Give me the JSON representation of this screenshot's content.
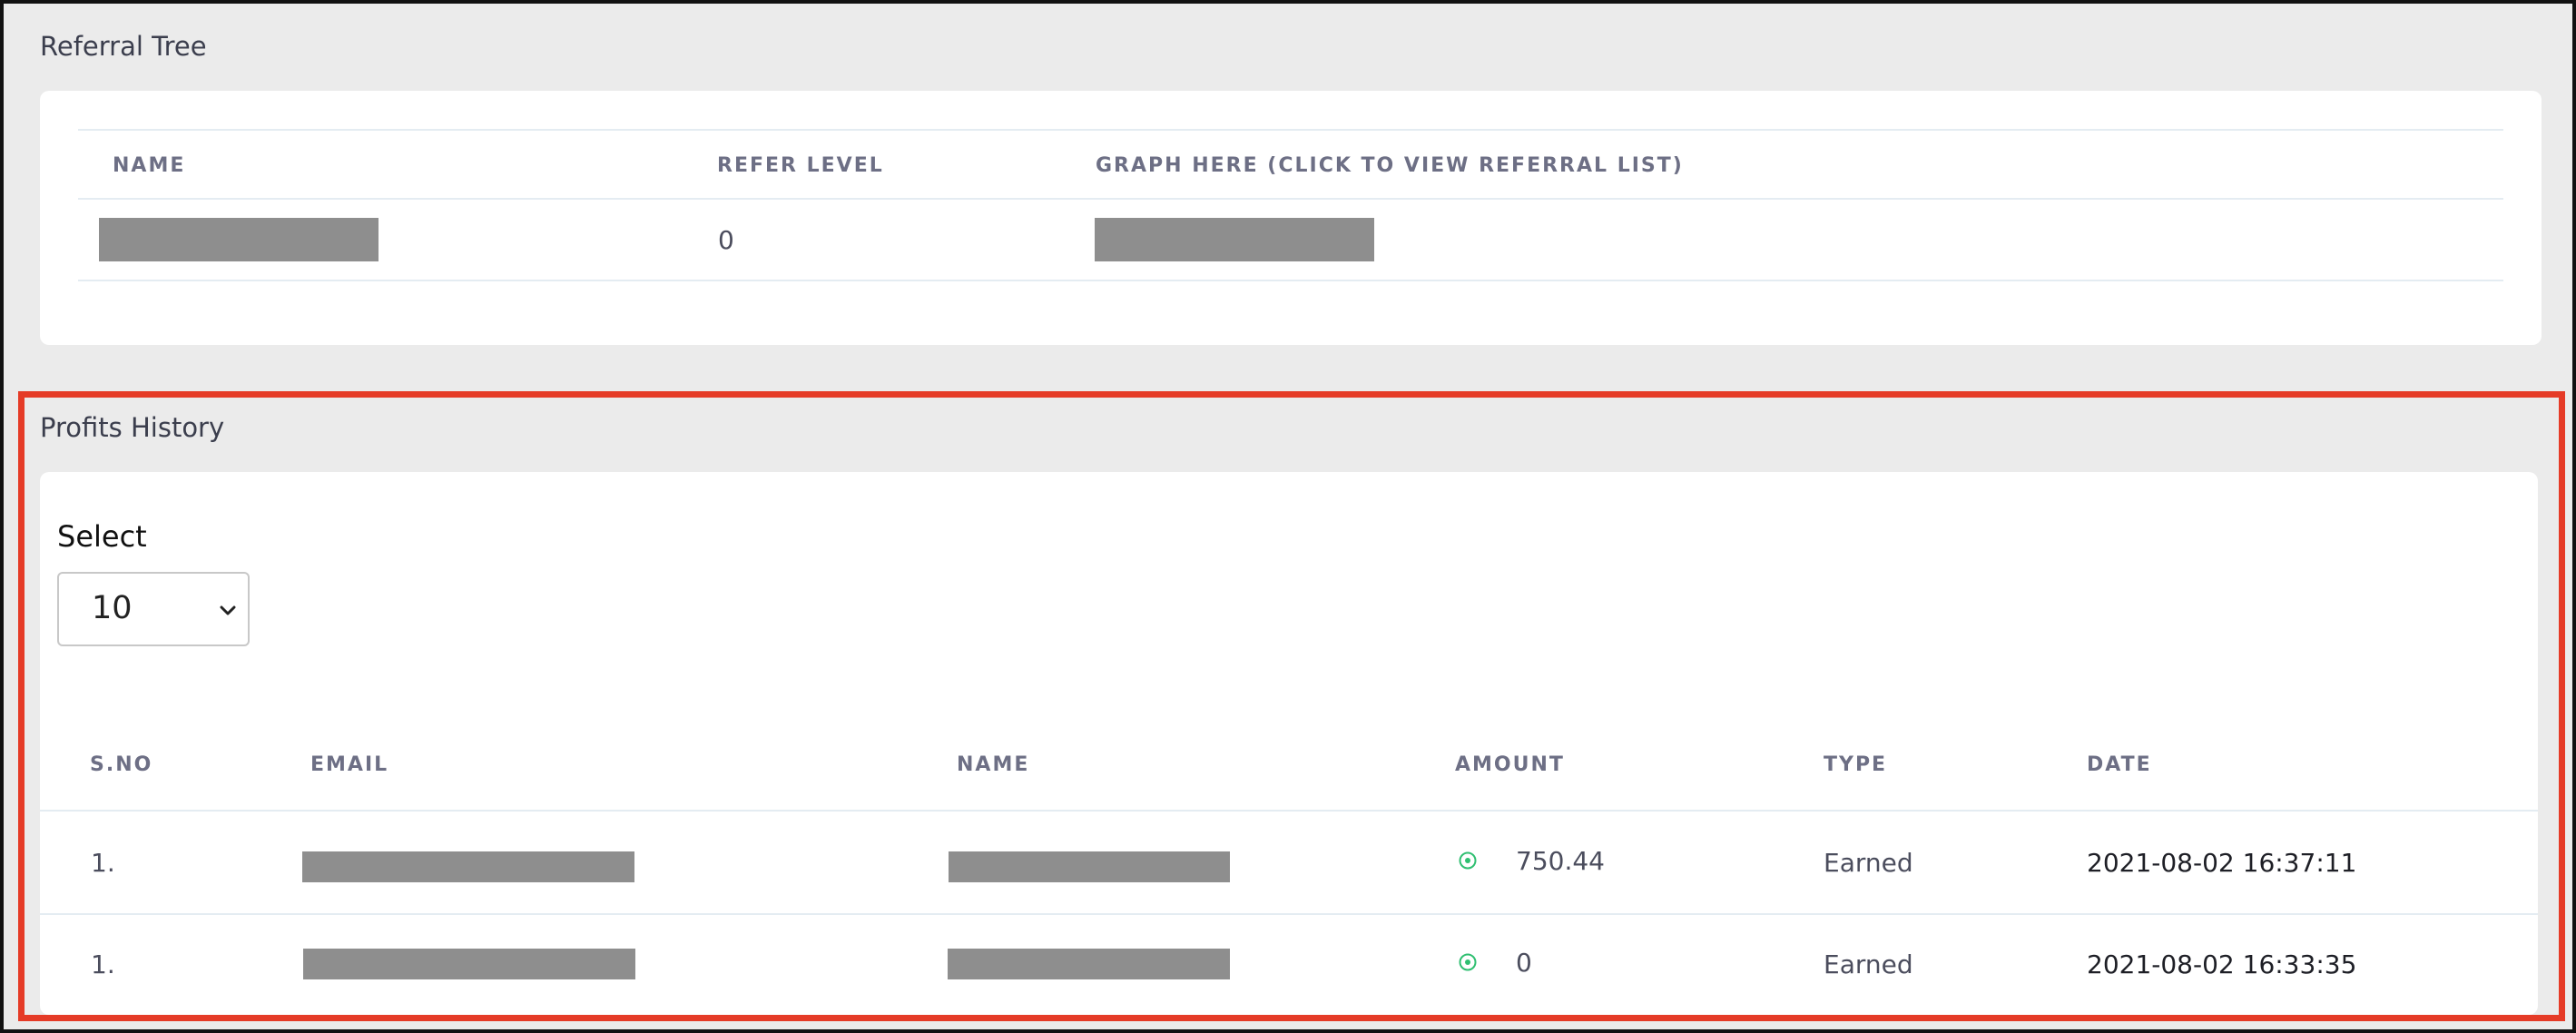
{
  "referral_tree": {
    "title": "Referral Tree",
    "columns": [
      "NAME",
      "REFER LEVEL",
      "GRAPH HERE (CLICK TO VIEW REFERRAL LIST)"
    ],
    "rows": [
      {
        "refer_level": "0"
      }
    ]
  },
  "profits_history": {
    "title": "Profits History",
    "select_label": "Select",
    "select_value": "10",
    "columns": [
      "S.NO",
      "EMAIL",
      "NAME",
      "AMOUNT",
      "TYPE",
      "DATE"
    ],
    "rows": [
      {
        "sno": "1.",
        "amount": "750.44",
        "type": "Earned",
        "date": "2021-08-02 16:37:11"
      },
      {
        "sno": "1.",
        "amount": "0",
        "type": "Earned",
        "date": "2021-08-02 16:33:35"
      }
    ],
    "amount_icon": "circle-dot-icon"
  },
  "colors": {
    "highlight": "#e53b27",
    "amount_icon": "#2fbf71",
    "redacted": "#8e8e8e"
  }
}
